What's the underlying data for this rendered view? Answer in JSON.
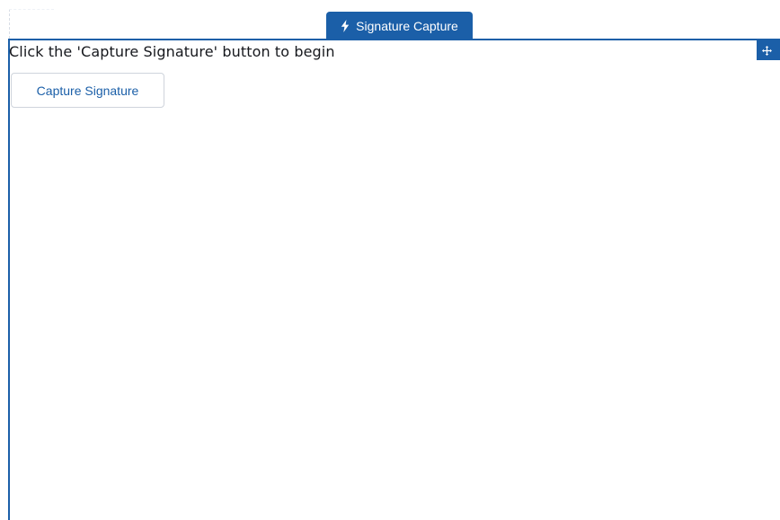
{
  "component_tab": {
    "icon": "lightning-bolt-icon",
    "label": "Signature Capture"
  },
  "frame_tools": {
    "move_icon": "move-icon",
    "delete_icon": "trash-icon"
  },
  "instruction_text": "Click the 'Capture Signature' button to begin",
  "capture_button": {
    "label": "Capture Signature"
  },
  "colors": {
    "accent": "#1b5fa8",
    "text": "#16181d",
    "button_border": "#cfd4dc"
  }
}
